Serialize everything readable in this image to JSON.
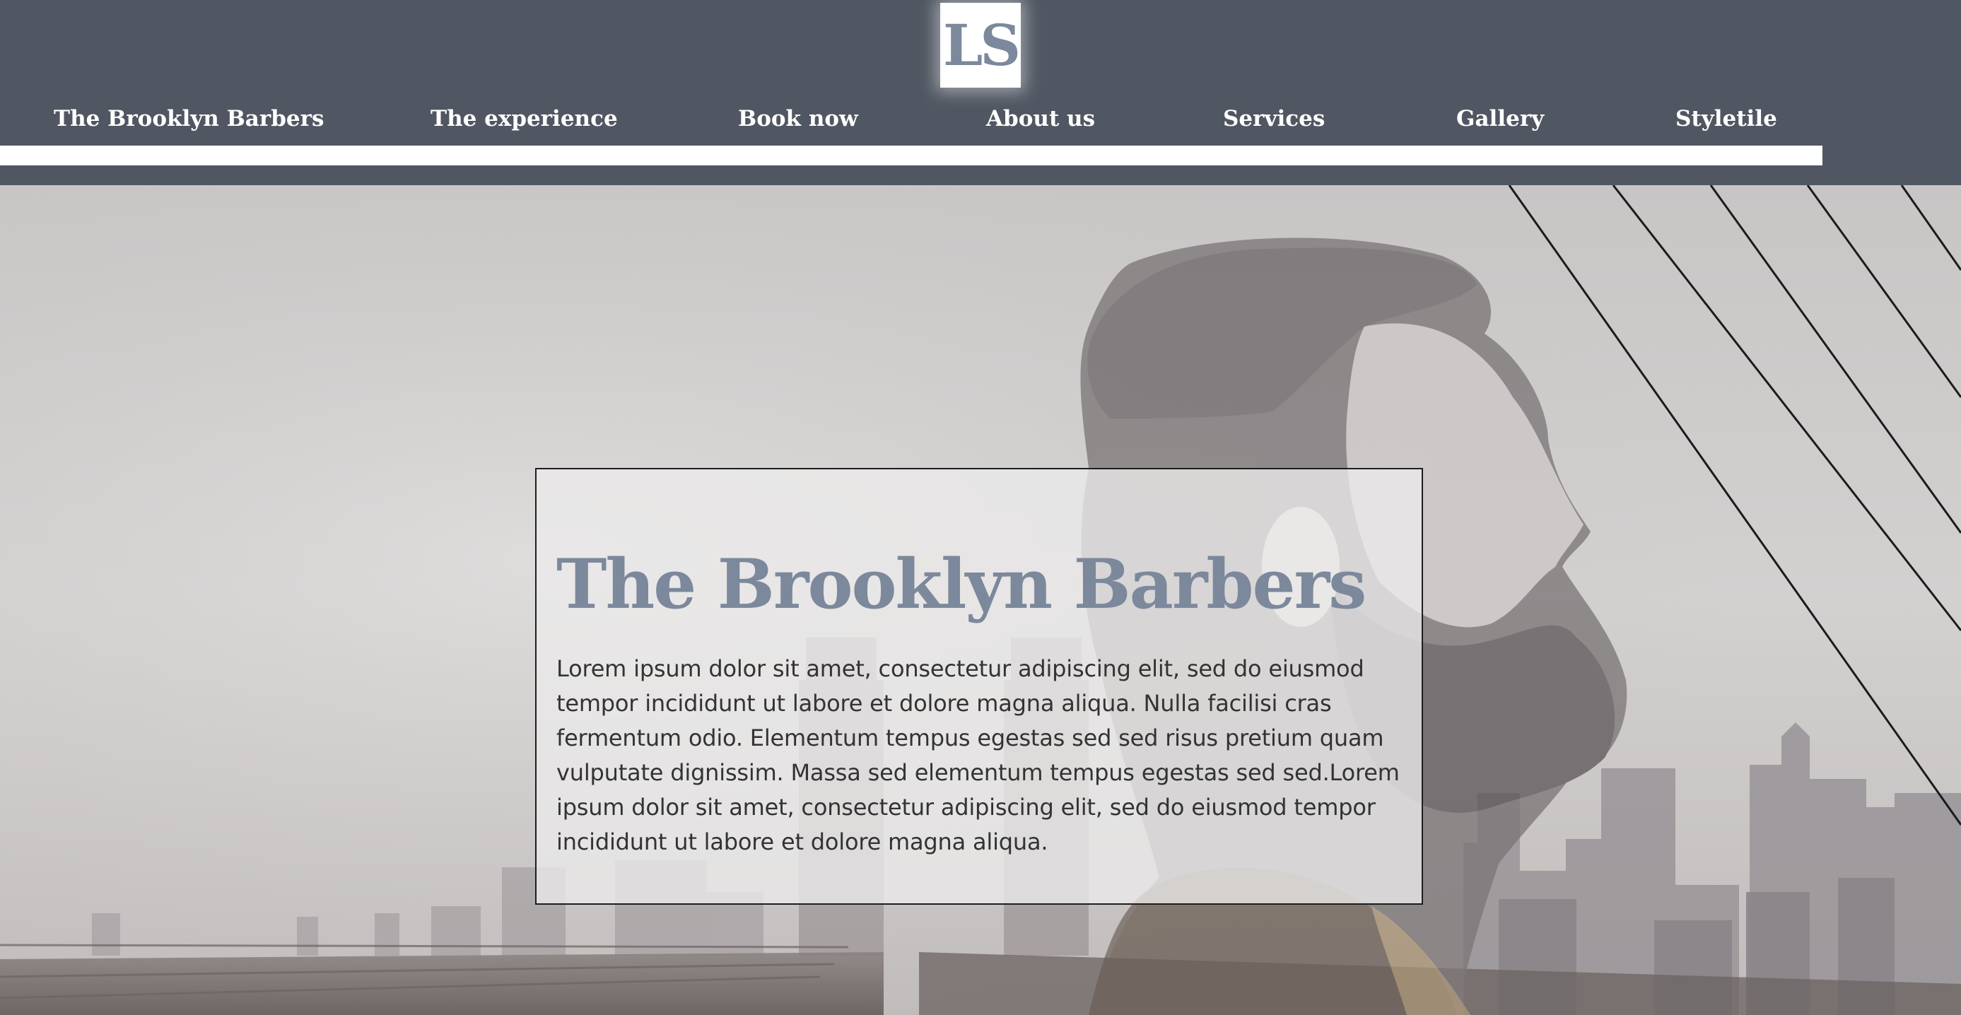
{
  "logo": {
    "text": "LS"
  },
  "nav": {
    "items": [
      {
        "label": "The Brooklyn Barbers"
      },
      {
        "label": "The experience"
      },
      {
        "label": "Book now"
      },
      {
        "label": "About us"
      },
      {
        "label": "Services"
      },
      {
        "label": "Gallery"
      },
      {
        "label": "Styletile"
      }
    ]
  },
  "hero": {
    "title": "The Brooklyn Barbers",
    "body": "Lorem ipsum dolor sit amet, consectetur adipiscing elit, sed do eiusmod tempor incididunt ut labore et dolore magna aliqua. Nulla facilisi cras fermentum odio. Elementum tempus egestas sed sed risus pretium quam vulputate dignissim. Massa sed elementum tempus egestas sed sed.Lorem ipsum dolor sit amet, consectetur adipiscing elit, sed do eiusmod tempor incididunt ut labore et dolore magna aliqua."
  },
  "colors": {
    "header_bg": "#505762",
    "accent_slate": "#7c889b",
    "nav_text": "#ffffff",
    "body_text": "#333333"
  }
}
